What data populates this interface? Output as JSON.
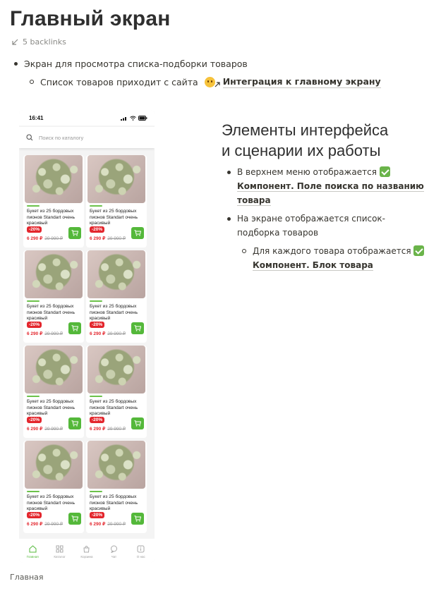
{
  "page": {
    "title": "Главный экран",
    "backlinks": "5 backlinks",
    "bullet_1": "Экран для просмотра списка-подборки товаров",
    "bullet_1_1_text": "Список товаров приходит с сайта",
    "bullet_1_1_link": "Интеграция к главному экрану",
    "caption": "Главная"
  },
  "phone": {
    "time": "16:41",
    "search_placeholder": "Поиск по каталогу",
    "products": [
      {
        "title": "Букет из 25 бордовых пионов Standart очень красивый",
        "discount": "-20%",
        "price": "6 290 ₽",
        "old_price": "29 990 ₽"
      },
      {
        "title": "Букет из 25 бордовых пионов Standart очень красивый",
        "discount": "-20%",
        "price": "6 290 ₽",
        "old_price": "29 990 ₽"
      },
      {
        "title": "Букет из 25 бордовых пионов Standart очень красивый",
        "discount": "-20%",
        "price": "6 290 ₽",
        "old_price": "29 990 ₽"
      },
      {
        "title": "Букет из 25 бордовых пионов Standart очень красивый",
        "discount": "-20%",
        "price": "6 290 ₽",
        "old_price": "29 990 ₽"
      },
      {
        "title": "Букет из 25 бордовых пионов Standart очень красивый",
        "discount": "-20%",
        "price": "6 290 ₽",
        "old_price": "29 990 ₽"
      },
      {
        "title": "Букет из 25 бордовых пионов Standart очень красивый",
        "discount": "-20%",
        "price": "6 290 ₽",
        "old_price": "29 990 ₽"
      },
      {
        "title": "Букет из 25 бордовых пионов Standart очень красивый",
        "discount": "-20%",
        "price": "6 290 ₽",
        "old_price": "29 990 ₽"
      },
      {
        "title": "Букет из 25 бордовых пионов Standart очень красивый",
        "discount": "-20%",
        "price": "6 290 ₽",
        "old_price": "29 990 ₽"
      }
    ],
    "tabs": [
      {
        "label": "Главная",
        "icon": "home-icon",
        "active": true
      },
      {
        "label": "Каталог",
        "icon": "catalog-icon",
        "active": false
      },
      {
        "label": "Корзина",
        "icon": "cart-icon",
        "active": false
      },
      {
        "label": "Чат",
        "icon": "chat-icon",
        "active": false
      },
      {
        "label": "О нас",
        "icon": "info-icon",
        "active": false
      }
    ]
  },
  "right": {
    "heading_line1": "Элементы интерфейса",
    "heading_line2": "и сценарии их работы",
    "item1_text": "В верхнем меню отображается",
    "item1_link": "Компонент. Поле поиска по названию товара",
    "item2_text": "На экране отображается список-подборка товаров",
    "item2_sub_text": "Для каждого товара отображается",
    "item2_sub_link": "Компонент. Блок товара"
  },
  "colors": {
    "accent_green": "#54b83a",
    "discount_red": "#e3262d"
  }
}
